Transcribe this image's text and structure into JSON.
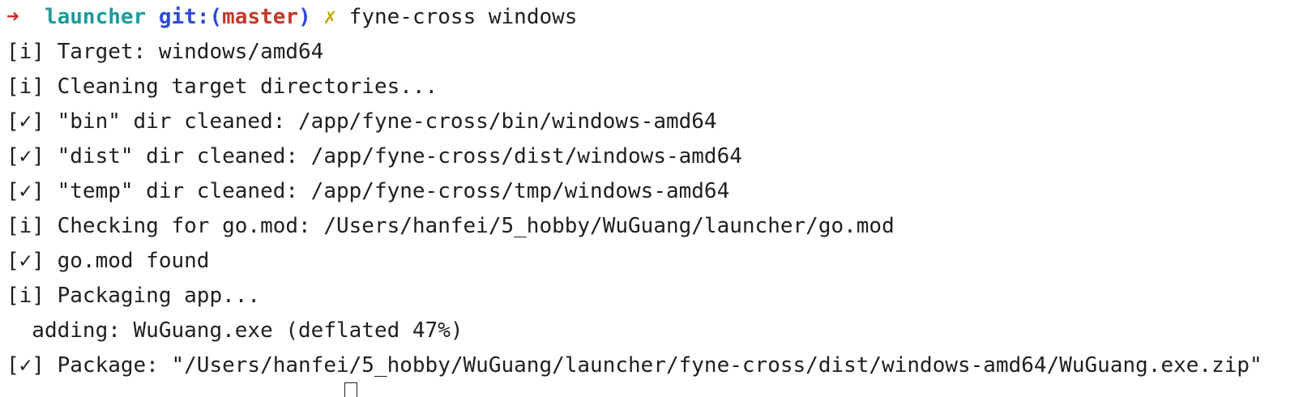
{
  "colors": {
    "arrow": "#d62828",
    "dir": "#1e9a9a",
    "git": "#2f4ad6",
    "branch": "#c0392b",
    "dirty": "#c7a400",
    "text": "#1f1f1f",
    "background": "#ffffff"
  },
  "prompt": {
    "arrow": "➜",
    "dir": "launcher",
    "git_prefix": "git:(",
    "branch": "master",
    "git_suffix": ")",
    "dirty_marker": "✗",
    "command": "fyne-cross windows"
  },
  "output": [
    "[i] Target: windows/amd64",
    "[i] Cleaning target directories...",
    "[✓] \"bin\" dir cleaned: /app/fyne-cross/bin/windows-amd64",
    "[✓] \"dist\" dir cleaned: /app/fyne-cross/dist/windows-amd64",
    "[✓] \"temp\" dir cleaned: /app/fyne-cross/tmp/windows-amd64",
    "[i] Checking for go.mod: /Users/hanfei/5_hobby/WuGuang/launcher/go.mod",
    "[✓] go.mod found",
    "[i] Packaging app...",
    "  adding: WuGuang.exe (deflated 47%)",
    "[✓] Package: \"/Users/hanfei/5_hobby/WuGuang/launcher/fyne-cross/dist/windows-amd64/WuGuang.exe.zip\""
  ]
}
